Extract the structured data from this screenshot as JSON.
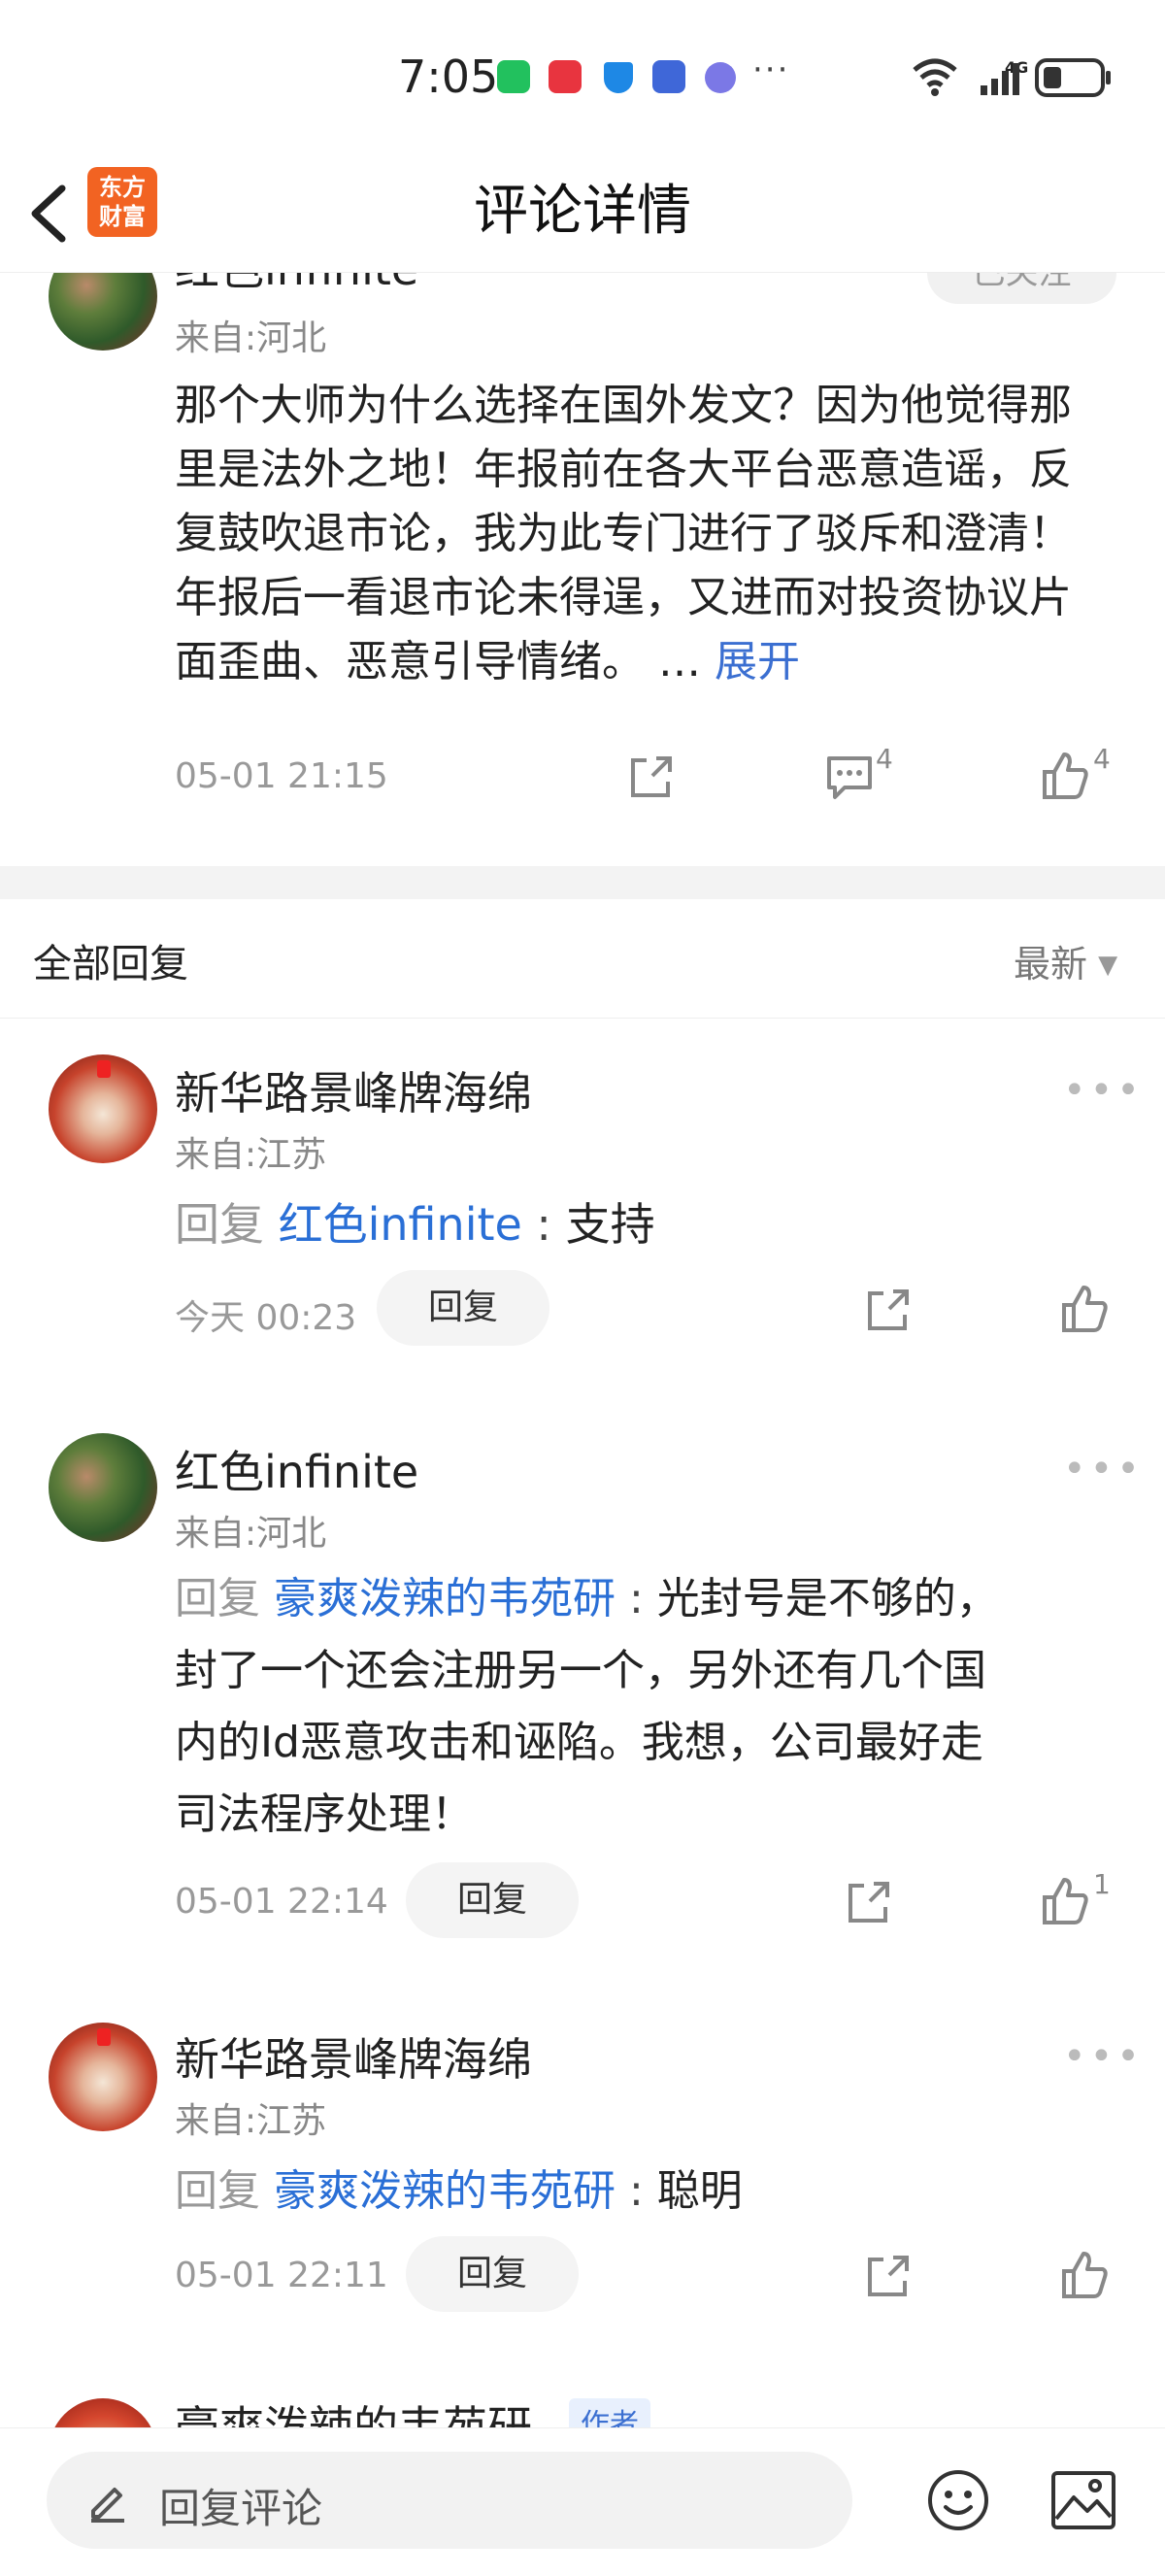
{
  "status_bar": {
    "time": "7:05",
    "more": "···",
    "network": "4G"
  },
  "header": {
    "title": "评论详情",
    "logo_line1": "东方",
    "logo_line2": "财富"
  },
  "main_comment": {
    "name_partial": "红色infinite",
    "follow_label": "已关注",
    "location": "来自:河北",
    "text": "那个大师为什么选择在国外发文？因为他觉得那里是法外之地！年报前在各大平台恶意造谣，反复鼓吹退市论，我为此专门进行了驳斥和澄清！年报后一看退市论未得逞，又进而对投资协议片面歪曲、恶意引导情绪。 …",
    "expand_label": "展开",
    "time": "05-01 21:15",
    "comment_count": "4",
    "like_count": "4"
  },
  "replies_section": {
    "label": "全部回复",
    "sort_label": "最新",
    "sort_arrow": "▼"
  },
  "replies": [
    {
      "name": "新华路景峰牌海绵",
      "location": "来自:江苏",
      "reply_prefix": "回复",
      "reply_target": "红色infinite",
      "separator": " : ",
      "text": "支持",
      "time": "今天 00:23",
      "reply_label": "回复",
      "like_count": ""
    },
    {
      "name": "红色infinite",
      "location": "来自:河北",
      "reply_prefix": "回复",
      "reply_target": "豪爽泼辣的韦苑研",
      "separator": " : ",
      "text_line1": "光封号是不够的，",
      "text_line2": "封了一个还会注册另一个，另外还有几个国",
      "text_line3": "内的Id恶意攻击和诬陷。我想，公司最好走",
      "text_line4": "司法程序处理！",
      "time": "05-01 22:14",
      "reply_label": "回复",
      "like_count": "1"
    },
    {
      "name": "新华路景峰牌海绵",
      "location": "来自:江苏",
      "reply_prefix": "回复",
      "reply_target": "豪爽泼辣的韦苑研",
      "separator": " : ",
      "text": "聪明",
      "time": "05-01 22:11",
      "reply_label": "回复",
      "like_count": ""
    },
    {
      "name_partial": "豪爽泼辣的韦苑研",
      "author_badge": "作者"
    }
  ],
  "bottom_bar": {
    "placeholder": "回复评论"
  },
  "colors": {
    "link_blue": "#2a6fd6",
    "brand_orange": "#f26322"
  }
}
